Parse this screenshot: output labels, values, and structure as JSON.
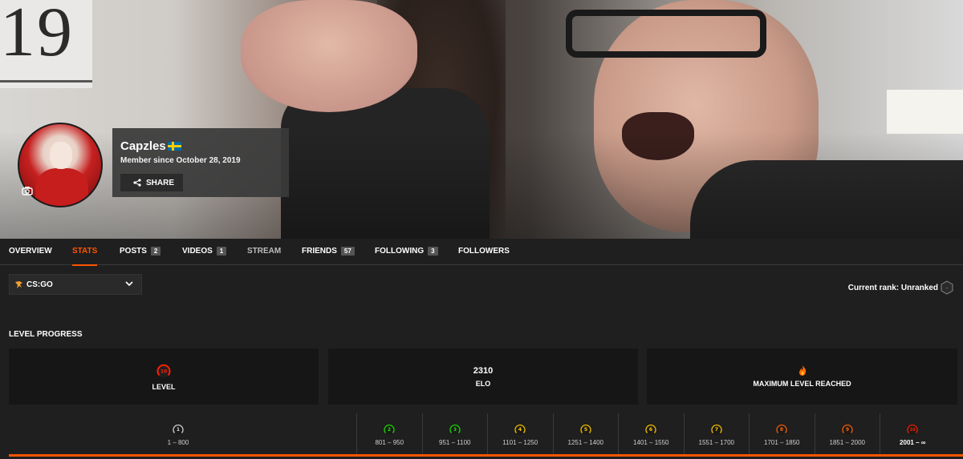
{
  "profile": {
    "username": "Capzles",
    "member_since": "Member since October 28, 2019",
    "share_label": "SHARE",
    "country_flag": "sweden"
  },
  "tabs": [
    {
      "label": "OVERVIEW"
    },
    {
      "label": "STATS"
    },
    {
      "label": "POSTS",
      "count": "2"
    },
    {
      "label": "VIDEOS",
      "count": "1"
    },
    {
      "label": "STREAM"
    },
    {
      "label": "FRIENDS",
      "count": "57"
    },
    {
      "label": "FOLLOWING",
      "count": "3"
    },
    {
      "label": "FOLLOWERS"
    }
  ],
  "game": {
    "name": "CS:GO"
  },
  "rank": {
    "label": "Current rank: Unranked"
  },
  "level_progress": {
    "title": "LEVEL PROGRESS",
    "level_label": "LEVEL",
    "level_value": "10",
    "elo_value": "2310",
    "elo_label": "ELO",
    "max_label": "MAXIMUM LEVEL REACHED"
  },
  "levels": [
    {
      "level": "1",
      "range": "1 – 800",
      "color": "#dddddd"
    },
    {
      "level": "2",
      "range": "801 – 950",
      "color": "#1ce400"
    },
    {
      "level": "3",
      "range": "951 – 1100",
      "color": "#1ce400"
    },
    {
      "level": "4",
      "range": "1101 – 1250",
      "color": "#ffc800"
    },
    {
      "level": "5",
      "range": "1251 – 1400",
      "color": "#ffc800"
    },
    {
      "level": "6",
      "range": "1401 – 1550",
      "color": "#ffc800"
    },
    {
      "level": "7",
      "range": "1551 – 1700",
      "color": "#ffc800"
    },
    {
      "level": "8",
      "range": "1701 – 1850",
      "color": "#ff6309"
    },
    {
      "level": "9",
      "range": "1851 – 2000",
      "color": "#ff6309"
    },
    {
      "level": "10",
      "range": "2001 – ∞",
      "color": "#fe1f00"
    }
  ],
  "colors": {
    "accent": "#ff5500",
    "background": "#1f1f1f",
    "card": "#161616"
  }
}
